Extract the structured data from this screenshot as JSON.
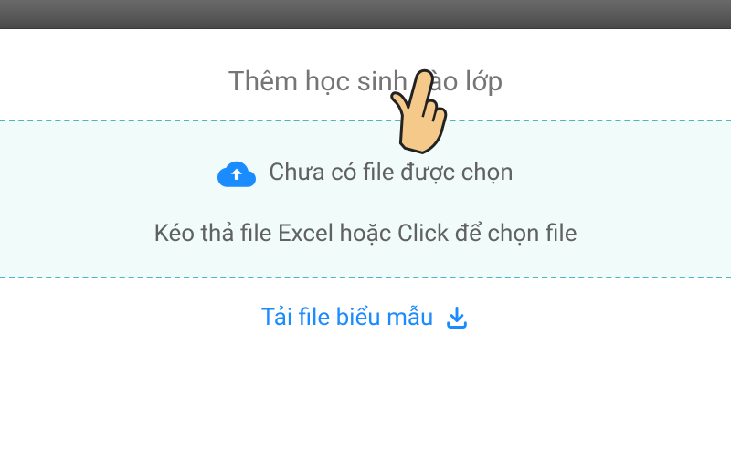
{
  "dialog": {
    "title": "Thêm học sinh vào lớp"
  },
  "dropzone": {
    "file_status": "Chưa có file được chọn",
    "instruction": "Kéo thả file Excel hoặc Click để chọn file"
  },
  "download": {
    "label": "Tải file biểu mẫu"
  }
}
